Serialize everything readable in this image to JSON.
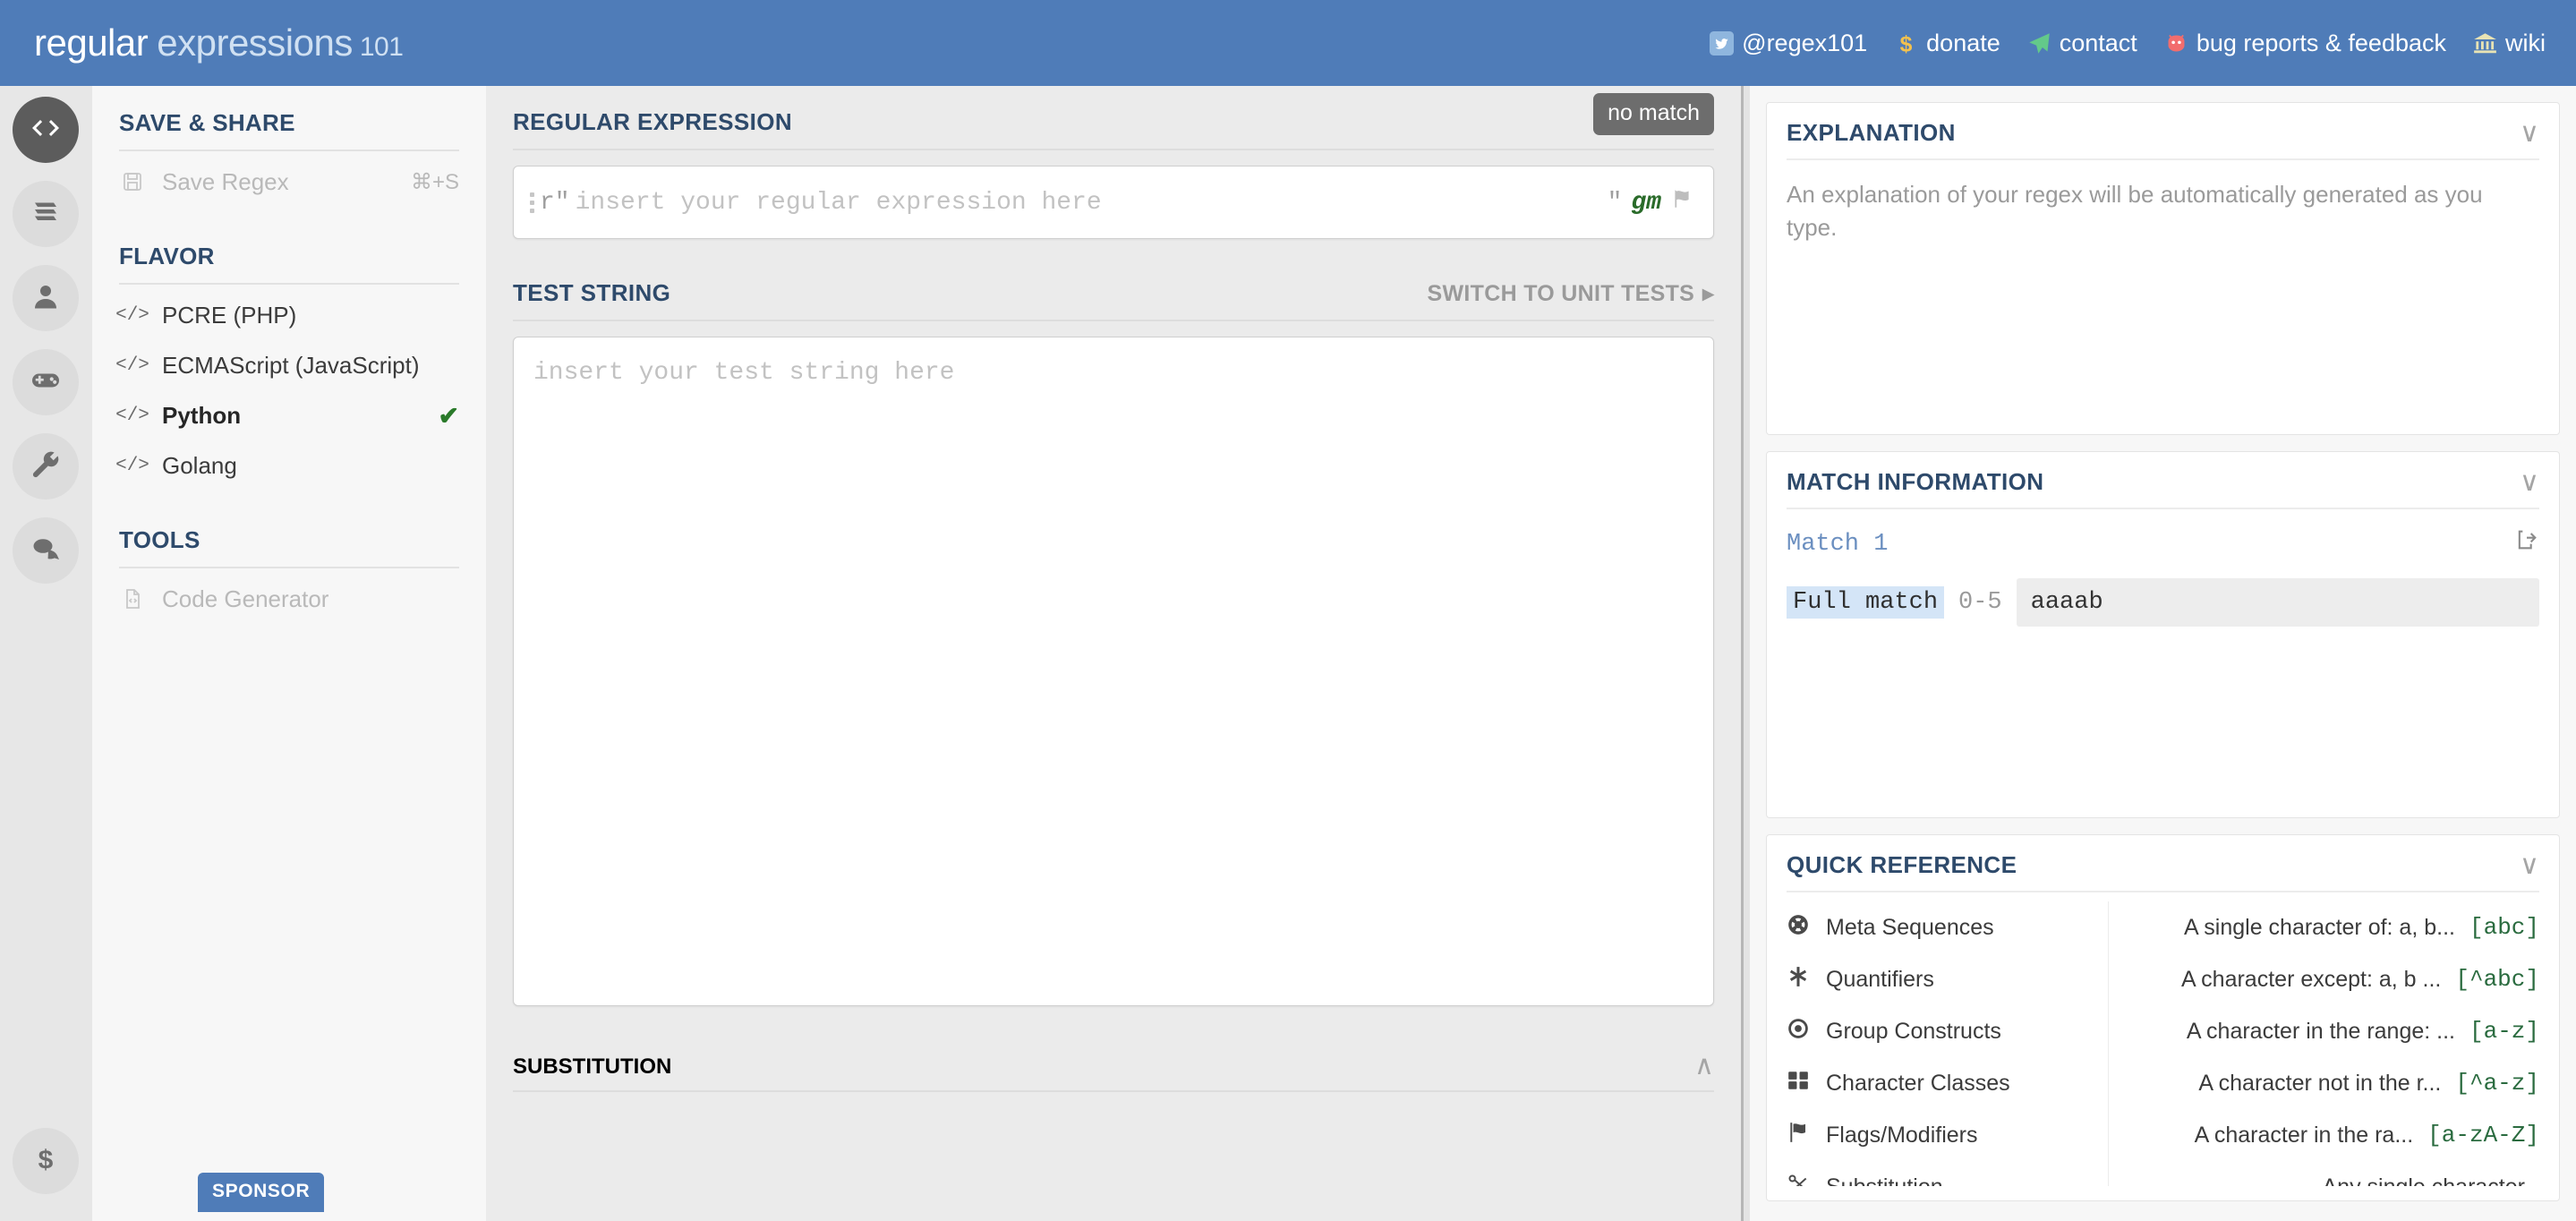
{
  "header": {
    "brand_regular": "regular",
    "brand_expressions": "expressions",
    "brand_101": "101",
    "nav": [
      {
        "icon": "twitter-icon",
        "label": "@regex101"
      },
      {
        "icon": "dollar-icon",
        "label": "donate"
      },
      {
        "icon": "paper-plane-icon",
        "label": "contact"
      },
      {
        "icon": "bug-icon",
        "label": "bug reports & feedback"
      },
      {
        "icon": "bank-icon",
        "label": "wiki"
      }
    ],
    "accent_color": "#4f7cb8"
  },
  "rail": {
    "items": [
      {
        "icon": "code-icon",
        "name": "regex-editor",
        "active": true
      },
      {
        "icon": "library-icon",
        "name": "library",
        "active": false
      },
      {
        "icon": "account-icon",
        "name": "account",
        "active": false
      },
      {
        "icon": "gamepad-icon",
        "name": "regex-quiz",
        "active": false
      },
      {
        "icon": "wrench-icon",
        "name": "tools",
        "active": false
      },
      {
        "icon": "chat-icon",
        "name": "community",
        "active": false
      }
    ],
    "bottom": {
      "icon": "dollar-icon",
      "name": "donate"
    }
  },
  "sidebar": {
    "save_share_title": "SAVE & SHARE",
    "save_regex_label": "Save Regex",
    "save_regex_shortcut": "⌘+S",
    "flavor_title": "FLAVOR",
    "flavors": [
      {
        "label": "PCRE (PHP)",
        "selected": false
      },
      {
        "label": "ECMAScript (JavaScript)",
        "selected": false
      },
      {
        "label": "Python",
        "selected": true
      },
      {
        "label": "Golang",
        "selected": false
      }
    ],
    "tools_title": "TOOLS",
    "code_generator_label": "Code Generator",
    "sponsor_label": "SPONSOR"
  },
  "main": {
    "regex_title": "REGULAR EXPRESSION",
    "no_match_badge": "no match",
    "regex_prefix": "r\"",
    "regex_placeholder": "insert your regular expression here",
    "regex_close_quote": "\"",
    "regex_flags": "gm",
    "test_string_title": "TEST STRING",
    "switch_unit_tests": "SWITCH TO UNIT TESTS",
    "switch_unit_tests_arrow": "▸",
    "test_string_placeholder": "insert your test string here",
    "substitution_title": "SUBSTITUTION",
    "substitution_chevron": "∧"
  },
  "right": {
    "explanation_title": "EXPLANATION",
    "explanation_text": "An explanation of your regex will be automatically generated as you type.",
    "explanation_chevron": "∨",
    "match_title": "MATCH INFORMATION",
    "match_chevron": "∨",
    "match_name": "Match 1",
    "match_label": "Full match",
    "match_range": "0-5",
    "match_value": "aaaab",
    "quick_ref_title": "QUICK REFERENCE",
    "quick_ref_chevron": "∨",
    "categories": [
      {
        "icon": "life-ring-icon",
        "label": "Meta Sequences"
      },
      {
        "icon": "asterisk-icon",
        "label": "Quantifiers"
      },
      {
        "icon": "dot-circle-icon",
        "label": "Group Constructs"
      },
      {
        "icon": "grid-icon",
        "label": "Character Classes"
      },
      {
        "icon": "flag-icon",
        "label": "Flags/Modifiers"
      },
      {
        "icon": "scissors-icon",
        "label": "Substitution"
      }
    ],
    "entries": [
      {
        "desc": "A single character of: a, b...",
        "code": "[abc]"
      },
      {
        "desc": "A character except: a, b ...",
        "code": "[^abc]"
      },
      {
        "desc": "A character in the range: ...",
        "code": "[a-z]"
      },
      {
        "desc": "A character not in the r...",
        "code": "[^a-z]"
      },
      {
        "desc": "A character in the ra...",
        "code": "[a-zA-Z]"
      },
      {
        "desc": "Any single character",
        "code": ""
      }
    ]
  }
}
